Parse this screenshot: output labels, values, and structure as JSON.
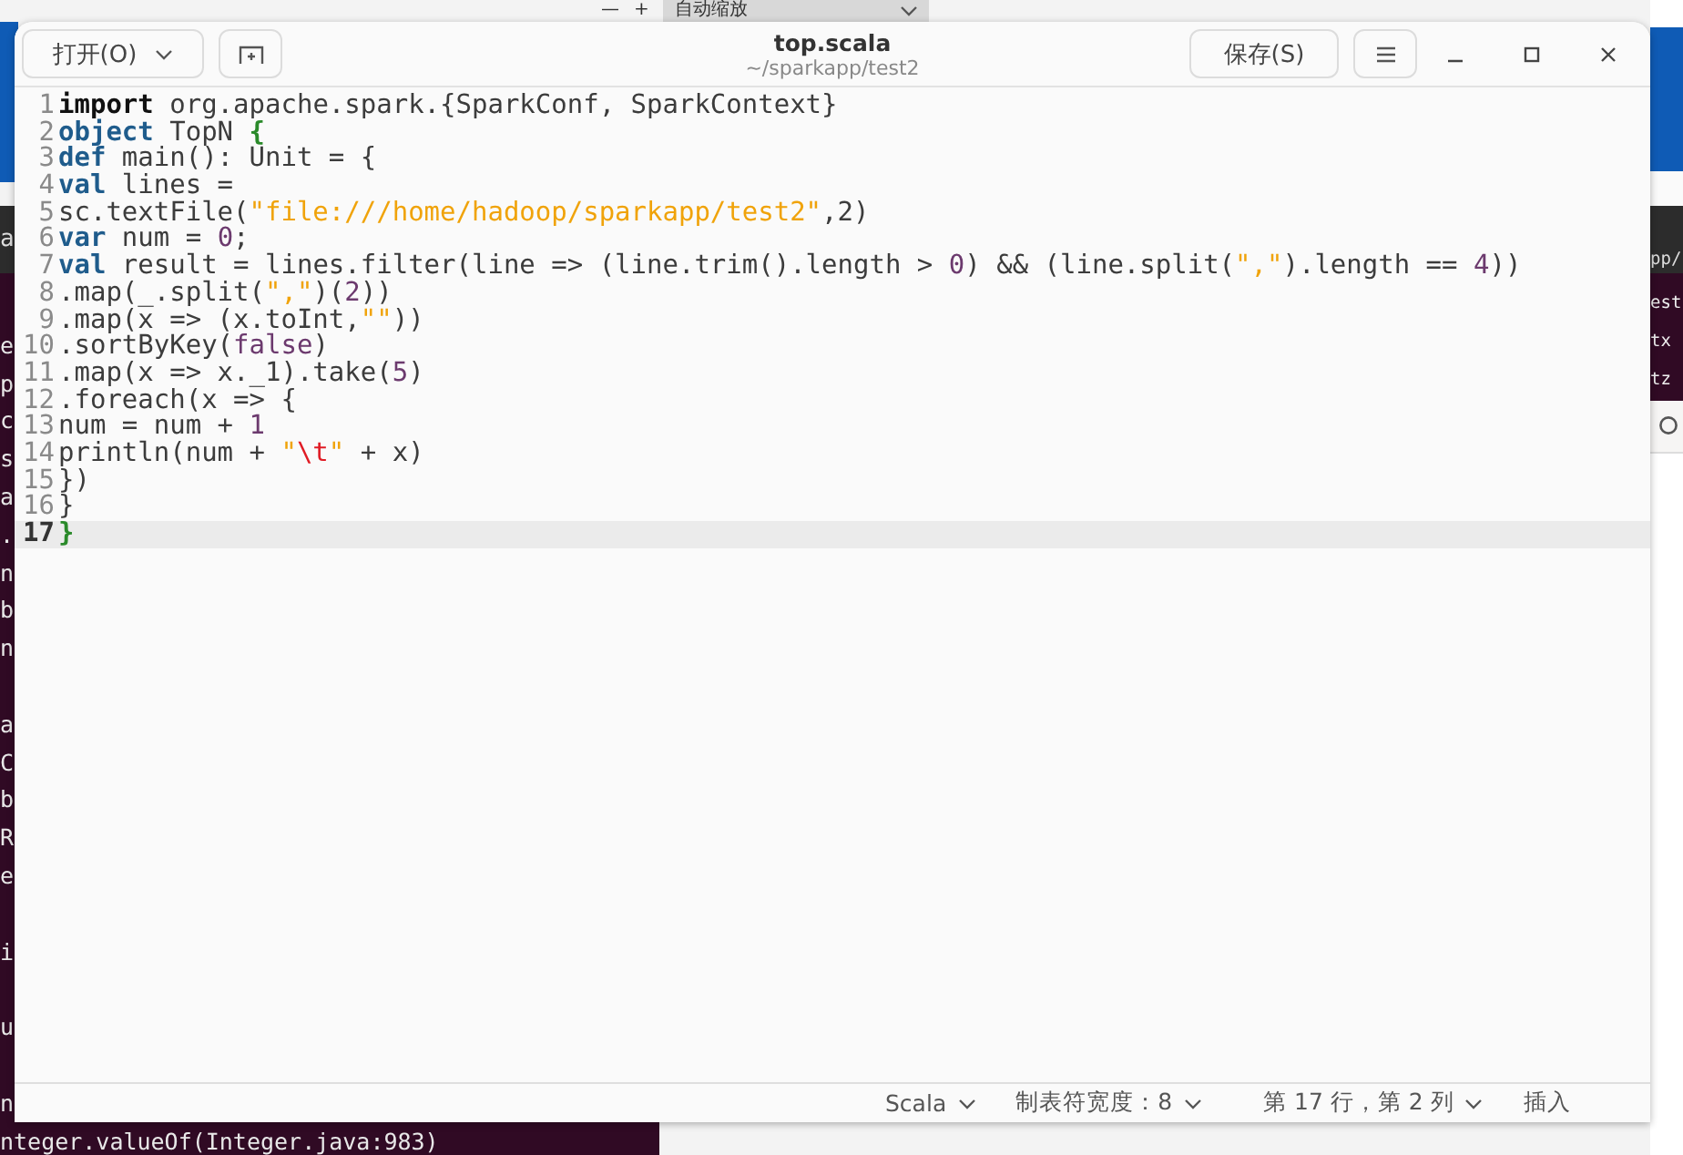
{
  "background": {
    "toolbar": {
      "minus": "—",
      "plus": "+",
      "zoom_dropdown": "自动缩放"
    },
    "terminal_left": {
      "header_fragment": "a",
      "lines": [
        {
          "kind": "text",
          "text": "e"
        },
        {
          "kind": "text",
          "text": "p"
        },
        {
          "kind": "text",
          "text": "c"
        },
        {
          "kind": "text",
          "text": "s"
        },
        {
          "kind": "text",
          "text": "a"
        },
        {
          "kind": "text",
          "text": "."
        },
        {
          "kind": "text",
          "text": "n"
        },
        {
          "kind": "text",
          "text": "b"
        },
        {
          "kind": "text",
          "text": "n"
        },
        {
          "kind": "gap"
        },
        {
          "kind": "text",
          "text": "a"
        },
        {
          "kind": "text",
          "text": "C"
        },
        {
          "kind": "text",
          "text": "b"
        },
        {
          "kind": "text",
          "text": "R"
        },
        {
          "kind": "text",
          "text": "e"
        },
        {
          "kind": "gap"
        },
        {
          "kind": "text",
          "text": "i"
        },
        {
          "kind": "gap"
        },
        {
          "kind": "text",
          "text": "u"
        },
        {
          "kind": "gap"
        },
        {
          "kind": "text",
          "text": "n"
        },
        {
          "kind": "text",
          "text": "nteger.valueOf(Integer.java:983)"
        }
      ]
    },
    "terminal_right": {
      "header_fragment": "pp/",
      "lines": [
        "est",
        "tx",
        "tz"
      ]
    }
  },
  "window": {
    "open_button": "打开(O)",
    "title": "top.scala",
    "subtitle": "~/sparkapp/test2",
    "save_button": "保存(S)"
  },
  "editor": {
    "lines": [
      {
        "number": "1",
        "current": false,
        "tokens": [
          {
            "kind": "import",
            "text": "import"
          },
          {
            "kind": "plain",
            "text": " org.apache.spark.{SparkConf, SparkContext}"
          }
        ]
      },
      {
        "number": "2",
        "current": false,
        "tokens": [
          {
            "kind": "keyword",
            "text": "object"
          },
          {
            "kind": "plain",
            "text": " TopN "
          },
          {
            "kind": "brace",
            "text": "{"
          }
        ]
      },
      {
        "number": "3",
        "current": false,
        "tokens": [
          {
            "kind": "keyword",
            "text": "def"
          },
          {
            "kind": "plain",
            "text": " main(): Unit = {"
          }
        ]
      },
      {
        "number": "4",
        "current": false,
        "tokens": [
          {
            "kind": "keyword",
            "text": "val"
          },
          {
            "kind": "plain",
            "text": " lines ="
          }
        ]
      },
      {
        "number": "5",
        "current": false,
        "tokens": [
          {
            "kind": "plain",
            "text": "sc.textFile("
          },
          {
            "kind": "string",
            "text": "\"file:///home/hadoop/sparkapp/test2\""
          },
          {
            "kind": "plain",
            "text": ",2)"
          }
        ]
      },
      {
        "number": "6",
        "current": false,
        "tokens": [
          {
            "kind": "keyword",
            "text": "var"
          },
          {
            "kind": "plain",
            "text": " num = "
          },
          {
            "kind": "number",
            "text": "0"
          },
          {
            "kind": "plain",
            "text": ";"
          }
        ]
      },
      {
        "number": "7",
        "current": false,
        "tokens": [
          {
            "kind": "keyword",
            "text": "val"
          },
          {
            "kind": "plain",
            "text": " result = lines.filter(line => (line.trim().length > "
          },
          {
            "kind": "number",
            "text": "0"
          },
          {
            "kind": "plain",
            "text": ") && (line.split("
          },
          {
            "kind": "string",
            "text": "\",\""
          },
          {
            "kind": "plain",
            "text": ").length == "
          },
          {
            "kind": "number",
            "text": "4"
          },
          {
            "kind": "plain",
            "text": "))"
          }
        ]
      },
      {
        "number": "8",
        "current": false,
        "tokens": [
          {
            "kind": "plain",
            "text": ".map(_.split("
          },
          {
            "kind": "string",
            "text": "\",\""
          },
          {
            "kind": "plain",
            "text": ")("
          },
          {
            "kind": "number",
            "text": "2"
          },
          {
            "kind": "plain",
            "text": "))"
          }
        ]
      },
      {
        "number": "9",
        "current": false,
        "tokens": [
          {
            "kind": "plain",
            "text": ".map(x => (x.toInt,"
          },
          {
            "kind": "string",
            "text": "\"\""
          },
          {
            "kind": "plain",
            "text": "))"
          }
        ]
      },
      {
        "number": "10",
        "current": false,
        "tokens": [
          {
            "kind": "plain",
            "text": ".sortByKey("
          },
          {
            "kind": "number",
            "text": "false"
          },
          {
            "kind": "plain",
            "text": ")"
          }
        ]
      },
      {
        "number": "11",
        "current": false,
        "tokens": [
          {
            "kind": "plain",
            "text": ".map(x => x._1).take("
          },
          {
            "kind": "number",
            "text": "5"
          },
          {
            "kind": "plain",
            "text": ")"
          }
        ]
      },
      {
        "number": "12",
        "current": false,
        "tokens": [
          {
            "kind": "plain",
            "text": ".foreach(x => {"
          }
        ]
      },
      {
        "number": "13",
        "current": false,
        "tokens": [
          {
            "kind": "plain",
            "text": "num = num + "
          },
          {
            "kind": "number",
            "text": "1"
          }
        ]
      },
      {
        "number": "14",
        "current": false,
        "tokens": [
          {
            "kind": "plain",
            "text": "println(num + "
          },
          {
            "kind": "string",
            "text": "\""
          },
          {
            "kind": "escape",
            "text": "\\t"
          },
          {
            "kind": "string",
            "text": "\""
          },
          {
            "kind": "plain",
            "text": " + x)"
          }
        ]
      },
      {
        "number": "15",
        "current": false,
        "tokens": [
          {
            "kind": "plain",
            "text": "})"
          }
        ]
      },
      {
        "number": "16",
        "current": false,
        "tokens": [
          {
            "kind": "plain",
            "text": "}"
          }
        ]
      },
      {
        "number": "17",
        "current": true,
        "tokens": [
          {
            "kind": "brace",
            "text": "}"
          }
        ]
      }
    ]
  },
  "status_bar": {
    "language": "Scala",
    "tab_width": "制表符宽度：8",
    "position": "第 17 行，第 2 列",
    "mode": "插入"
  }
}
